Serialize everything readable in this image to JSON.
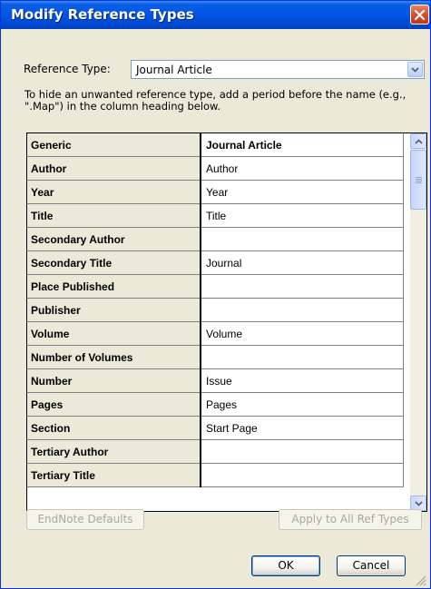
{
  "window": {
    "title": "Modify Reference Types"
  },
  "ref_type": {
    "label": "Reference Type:",
    "value": "Journal Article"
  },
  "hint": "To hide an unwanted reference type, add a period before the name (e.g., \".Map\") in the column heading below.",
  "rows": [
    {
      "field": "Generic",
      "value": "Journal Article"
    },
    {
      "field": "Author",
      "value": "Author"
    },
    {
      "field": "Year",
      "value": "Year"
    },
    {
      "field": "Title",
      "value": "Title"
    },
    {
      "field": "Secondary Author",
      "value": ""
    },
    {
      "field": "Secondary Title",
      "value": "Journal"
    },
    {
      "field": "Place Published",
      "value": ""
    },
    {
      "field": "Publisher",
      "value": ""
    },
    {
      "field": "Volume",
      "value": "Volume"
    },
    {
      "field": "Number of Volumes",
      "value": ""
    },
    {
      "field": "Number",
      "value": "Issue"
    },
    {
      "field": "Pages",
      "value": "Pages"
    },
    {
      "field": "Section",
      "value": "Start Page"
    },
    {
      "field": "Tertiary Author",
      "value": ""
    },
    {
      "field": "Tertiary Title",
      "value": ""
    }
  ],
  "buttons": {
    "endnote_defaults": "EndNote Defaults",
    "apply_all": "Apply to All Ref Types",
    "ok": "OK",
    "cancel": "Cancel"
  },
  "colors": {
    "titlebar": "#0055e5",
    "dialog_bg": "#ece9d8",
    "close_button": "#d74f2a"
  }
}
